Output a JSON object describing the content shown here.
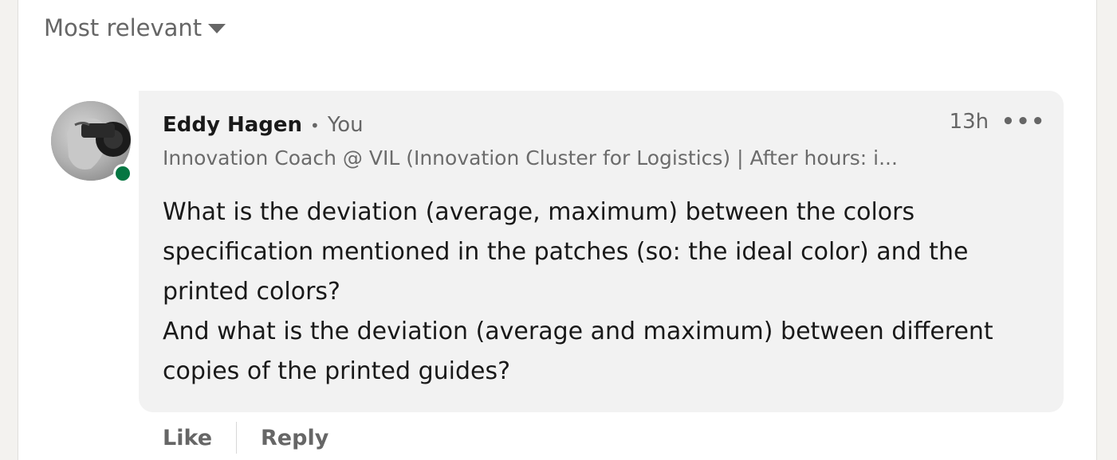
{
  "sort": {
    "label": "Most relevant"
  },
  "comment": {
    "author": "Eddy Hagen",
    "separator": "•",
    "relationship": "You",
    "headline": "Innovation Coach @ VIL (Innovation Cluster for Logistics) | After hours: i...",
    "time": "13h",
    "more_label": "•••",
    "text": "What is the deviation (average, maximum) between the colors\nspecification mentioned in the patches (so: the ideal color) and the\nprinted colors?\nAnd what is the deviation (average and maximum) between different\ncopies of the printed guides?",
    "presence_status": "online",
    "presence_color": "#057642"
  },
  "actions": {
    "like_label": "Like",
    "reply_label": "Reply"
  },
  "colors": {
    "page_bg": "#f3f2ef",
    "bubble_bg": "#f2f2f2",
    "text_primary": "#191919",
    "text_secondary": "#666666"
  },
  "icons": {
    "sort": "caret-down-icon",
    "more": "ellipsis-icon"
  }
}
